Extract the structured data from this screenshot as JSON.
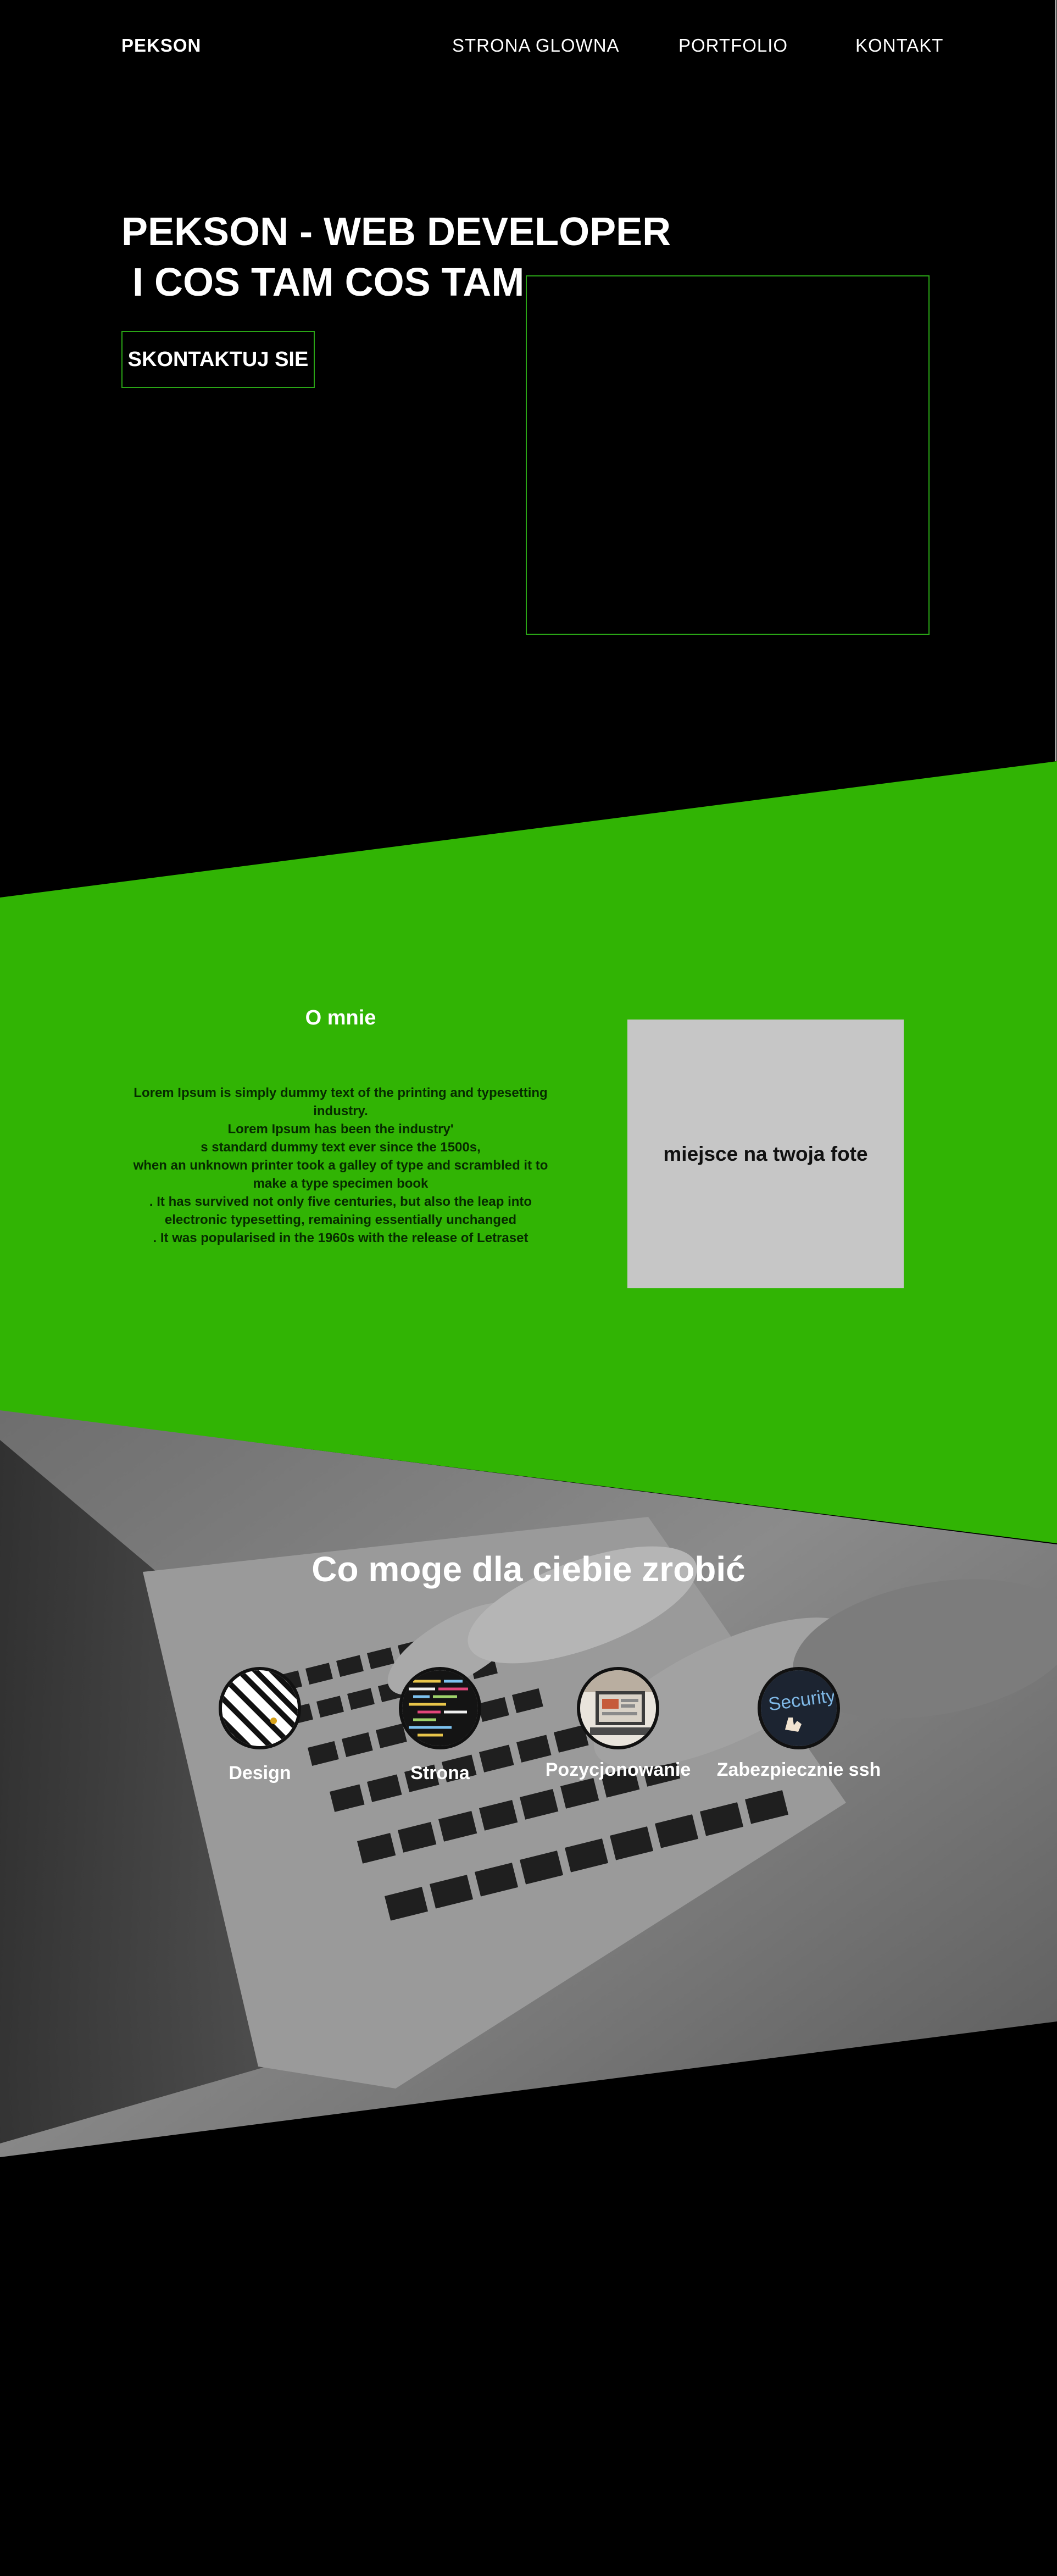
{
  "nav": {
    "logo": "PEKSON",
    "links": [
      "STRONA GLOWNA",
      "PORTFOLIO",
      "KONTAKT"
    ]
  },
  "hero": {
    "title_line1": "PEKSON - WEB DEVELOPER",
    "title_line2": " I COS TAM COS TAM",
    "cta": "SKONTAKTUJ SIE"
  },
  "about": {
    "title": "O mnie",
    "lines": [
      "Lorem Ipsum is simply dummy text of the printing and typesetting",
      "industry.",
      "Lorem Ipsum has been the industry'",
      "s standard dummy text ever since the 1500s,",
      "when an unknown printer took a galley of type and scrambled it to",
      "make a type specimen book",
      ". It has survived not only five centuries, but also the leap into",
      "electronic typesetting, remaining essentially unchanged",
      ". It was popularised in the 1960s with the release of Letraset"
    ],
    "photo_placeholder": "miejsce na twoja fote"
  },
  "services": {
    "title": "Co moge dla ciebie zrobić",
    "items": [
      {
        "label": "Design",
        "icon": "design-stripes-icon"
      },
      {
        "label": "Strona",
        "icon": "code-editor-icon"
      },
      {
        "label": "Pozycjonowanie",
        "icon": "analytics-screen-icon"
      },
      {
        "label": "Zabezpiecznie ssh",
        "icon": "security-icon"
      }
    ]
  },
  "colors": {
    "background": "#000000",
    "accent_green": "#31b404",
    "photo_box": "#c6c6c6"
  }
}
